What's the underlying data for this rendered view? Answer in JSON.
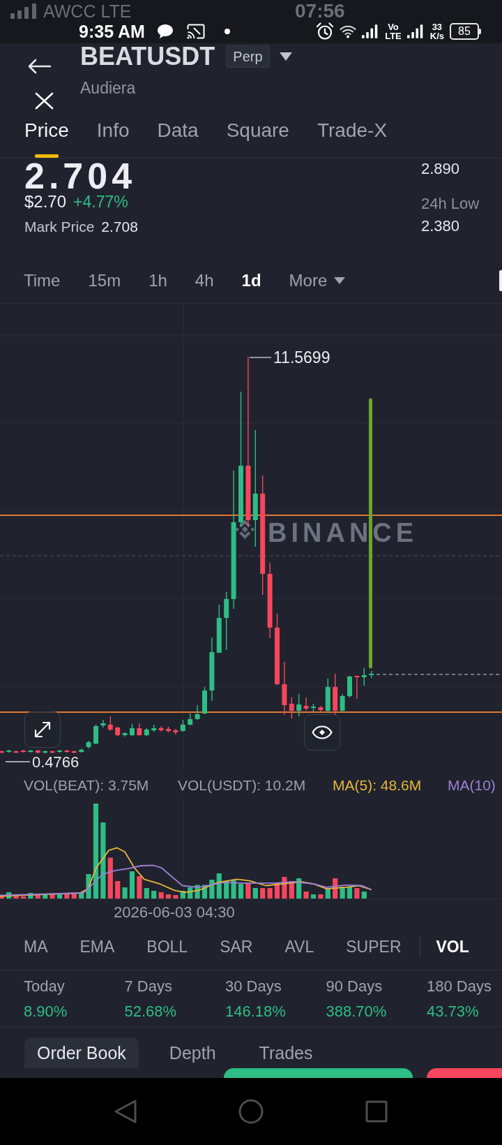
{
  "status_bar": {
    "back_layer": {
      "carrier": "AWCC LTE",
      "time": "07:56"
    },
    "time": "9:35 AM",
    "network": [
      "Vo",
      "LTE"
    ],
    "speed": {
      "value": "33",
      "unit": "K/s"
    },
    "battery": "85"
  },
  "header": {
    "symbol": "BEATUSDT",
    "badge": "Perp",
    "name": "Audiera"
  },
  "tabs": [
    {
      "label": "Price",
      "selected": true
    },
    {
      "label": "Info",
      "selected": false
    },
    {
      "label": "Data",
      "selected": false
    },
    {
      "label": "Square",
      "selected": false
    },
    {
      "label": "Trade-X",
      "selected": false
    }
  ],
  "price": {
    "last": "2.704",
    "usd": "$2.70",
    "change": "+4.77%",
    "mark_label": "Mark Price",
    "mark_value": "2.708",
    "high_value": "2.890",
    "low_label": "24h Low",
    "low_value": "2.380"
  },
  "intervals": [
    {
      "label": "Time",
      "selected": false,
      "kind": "option"
    },
    {
      "label": "15m",
      "selected": false,
      "kind": "option"
    },
    {
      "label": "1h",
      "selected": false,
      "kind": "option"
    },
    {
      "label": "4h",
      "selected": false,
      "kind": "option"
    },
    {
      "label": "1d",
      "selected": true,
      "kind": "option"
    },
    {
      "label": "More",
      "selected": false,
      "kind": "dropdown"
    }
  ],
  "chart": {
    "high_label": "11.5699",
    "low_label": "0.4766",
    "watermark": "BINANCE"
  },
  "volume": {
    "legend": [
      {
        "text": "VOL(BEAT): 3.75M",
        "color": "#9aa0ab"
      },
      {
        "text": "VOL(USDT): 10.2M",
        "color": "#9aa0ab"
      },
      {
        "text": "MA(5): 48.6M",
        "color": "#e8b53c"
      },
      {
        "text": "MA(10)",
        "color": "#9b7fd6"
      }
    ],
    "date_label": "2026-06-03 04:30"
  },
  "indicators": [
    {
      "label": "MA",
      "selected": false,
      "kind": "main"
    },
    {
      "label": "EMA",
      "selected": false,
      "kind": "main"
    },
    {
      "label": "BOLL",
      "selected": false,
      "kind": "main"
    },
    {
      "label": "SAR",
      "selected": false,
      "kind": "main"
    },
    {
      "label": "AVL",
      "selected": false,
      "kind": "main"
    },
    {
      "label": "SUPER",
      "selected": false,
      "kind": "main"
    },
    {
      "label": "VOL",
      "selected": true,
      "kind": "sub"
    }
  ],
  "performance": [
    {
      "period": "Today",
      "value": "8.90%"
    },
    {
      "period": "7 Days",
      "value": "52.68%"
    },
    {
      "period": "30 Days",
      "value": "146.18%"
    },
    {
      "period": "90 Days",
      "value": "388.70%"
    },
    {
      "period": "180 Days",
      "value": "43.73%"
    }
  ],
  "book_tabs": [
    {
      "label": "Order Book",
      "selected": true
    },
    {
      "label": "Depth",
      "selected": false
    },
    {
      "label": "Trades",
      "selected": false
    }
  ]
}
